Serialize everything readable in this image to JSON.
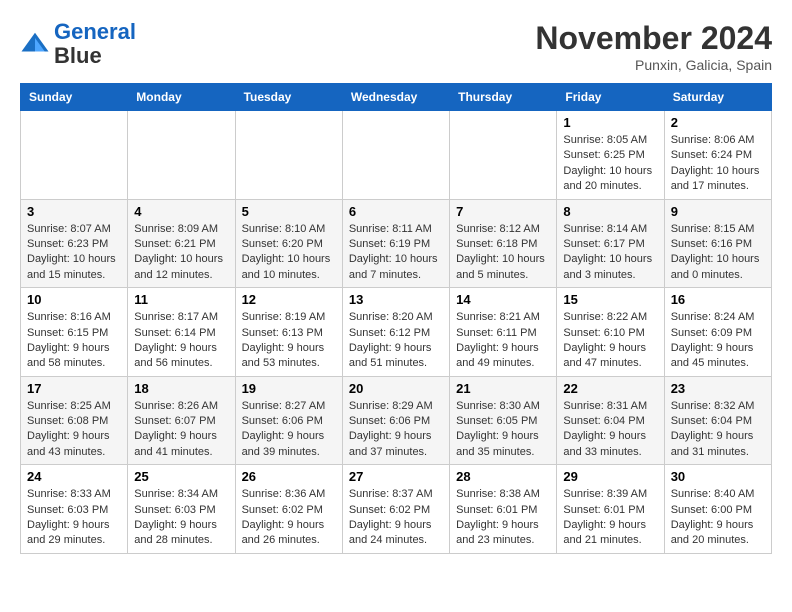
{
  "header": {
    "logo_line1": "General",
    "logo_line2": "Blue",
    "month_title": "November 2024",
    "subtitle": "Punxin, Galicia, Spain"
  },
  "weekdays": [
    "Sunday",
    "Monday",
    "Tuesday",
    "Wednesday",
    "Thursday",
    "Friday",
    "Saturday"
  ],
  "weeks": [
    [
      {
        "day": "",
        "info": ""
      },
      {
        "day": "",
        "info": ""
      },
      {
        "day": "",
        "info": ""
      },
      {
        "day": "",
        "info": ""
      },
      {
        "day": "",
        "info": ""
      },
      {
        "day": "1",
        "info": "Sunrise: 8:05 AM\nSunset: 6:25 PM\nDaylight: 10 hours\nand 20 minutes."
      },
      {
        "day": "2",
        "info": "Sunrise: 8:06 AM\nSunset: 6:24 PM\nDaylight: 10 hours\nand 17 minutes."
      }
    ],
    [
      {
        "day": "3",
        "info": "Sunrise: 8:07 AM\nSunset: 6:23 PM\nDaylight: 10 hours\nand 15 minutes."
      },
      {
        "day": "4",
        "info": "Sunrise: 8:09 AM\nSunset: 6:21 PM\nDaylight: 10 hours\nand 12 minutes."
      },
      {
        "day": "5",
        "info": "Sunrise: 8:10 AM\nSunset: 6:20 PM\nDaylight: 10 hours\nand 10 minutes."
      },
      {
        "day": "6",
        "info": "Sunrise: 8:11 AM\nSunset: 6:19 PM\nDaylight: 10 hours\nand 7 minutes."
      },
      {
        "day": "7",
        "info": "Sunrise: 8:12 AM\nSunset: 6:18 PM\nDaylight: 10 hours\nand 5 minutes."
      },
      {
        "day": "8",
        "info": "Sunrise: 8:14 AM\nSunset: 6:17 PM\nDaylight: 10 hours\nand 3 minutes."
      },
      {
        "day": "9",
        "info": "Sunrise: 8:15 AM\nSunset: 6:16 PM\nDaylight: 10 hours\nand 0 minutes."
      }
    ],
    [
      {
        "day": "10",
        "info": "Sunrise: 8:16 AM\nSunset: 6:15 PM\nDaylight: 9 hours\nand 58 minutes."
      },
      {
        "day": "11",
        "info": "Sunrise: 8:17 AM\nSunset: 6:14 PM\nDaylight: 9 hours\nand 56 minutes."
      },
      {
        "day": "12",
        "info": "Sunrise: 8:19 AM\nSunset: 6:13 PM\nDaylight: 9 hours\nand 53 minutes."
      },
      {
        "day": "13",
        "info": "Sunrise: 8:20 AM\nSunset: 6:12 PM\nDaylight: 9 hours\nand 51 minutes."
      },
      {
        "day": "14",
        "info": "Sunrise: 8:21 AM\nSunset: 6:11 PM\nDaylight: 9 hours\nand 49 minutes."
      },
      {
        "day": "15",
        "info": "Sunrise: 8:22 AM\nSunset: 6:10 PM\nDaylight: 9 hours\nand 47 minutes."
      },
      {
        "day": "16",
        "info": "Sunrise: 8:24 AM\nSunset: 6:09 PM\nDaylight: 9 hours\nand 45 minutes."
      }
    ],
    [
      {
        "day": "17",
        "info": "Sunrise: 8:25 AM\nSunset: 6:08 PM\nDaylight: 9 hours\nand 43 minutes."
      },
      {
        "day": "18",
        "info": "Sunrise: 8:26 AM\nSunset: 6:07 PM\nDaylight: 9 hours\nand 41 minutes."
      },
      {
        "day": "19",
        "info": "Sunrise: 8:27 AM\nSunset: 6:06 PM\nDaylight: 9 hours\nand 39 minutes."
      },
      {
        "day": "20",
        "info": "Sunrise: 8:29 AM\nSunset: 6:06 PM\nDaylight: 9 hours\nand 37 minutes."
      },
      {
        "day": "21",
        "info": "Sunrise: 8:30 AM\nSunset: 6:05 PM\nDaylight: 9 hours\nand 35 minutes."
      },
      {
        "day": "22",
        "info": "Sunrise: 8:31 AM\nSunset: 6:04 PM\nDaylight: 9 hours\nand 33 minutes."
      },
      {
        "day": "23",
        "info": "Sunrise: 8:32 AM\nSunset: 6:04 PM\nDaylight: 9 hours\nand 31 minutes."
      }
    ],
    [
      {
        "day": "24",
        "info": "Sunrise: 8:33 AM\nSunset: 6:03 PM\nDaylight: 9 hours\nand 29 minutes."
      },
      {
        "day": "25",
        "info": "Sunrise: 8:34 AM\nSunset: 6:03 PM\nDaylight: 9 hours\nand 28 minutes."
      },
      {
        "day": "26",
        "info": "Sunrise: 8:36 AM\nSunset: 6:02 PM\nDaylight: 9 hours\nand 26 minutes."
      },
      {
        "day": "27",
        "info": "Sunrise: 8:37 AM\nSunset: 6:02 PM\nDaylight: 9 hours\nand 24 minutes."
      },
      {
        "day": "28",
        "info": "Sunrise: 8:38 AM\nSunset: 6:01 PM\nDaylight: 9 hours\nand 23 minutes."
      },
      {
        "day": "29",
        "info": "Sunrise: 8:39 AM\nSunset: 6:01 PM\nDaylight: 9 hours\nand 21 minutes."
      },
      {
        "day": "30",
        "info": "Sunrise: 8:40 AM\nSunset: 6:00 PM\nDaylight: 9 hours\nand 20 minutes."
      }
    ]
  ]
}
